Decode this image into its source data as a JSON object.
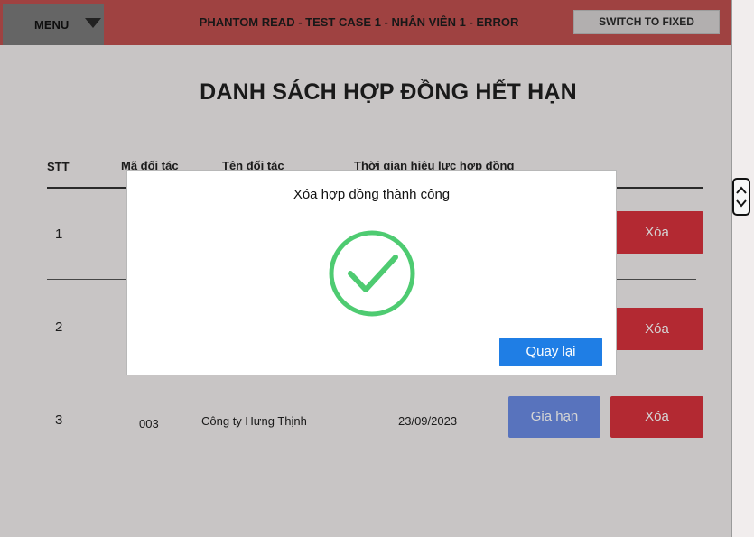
{
  "topbar": {
    "menu_label": "MENU",
    "title": "PHANTOM READ - TEST CASE 1 - NHÂN VIÊN 1 - ERROR",
    "switch_label": "SWITCH TO FIXED"
  },
  "page": {
    "title": "DANH SÁCH HỢP ĐỒNG HẾT HẠN"
  },
  "table": {
    "headers": [
      "STT",
      "Mã đối tác",
      "Tên đối tác",
      "Thời gian hiệu lực hợp đồng"
    ],
    "rows": [
      {
        "stt": "1",
        "delete_label": "Xóa"
      },
      {
        "stt": "2",
        "delete_label": "Xóa"
      },
      {
        "stt": "3",
        "code": "003",
        "name": "Công ty Hưng Thịnh",
        "date": "23/09/2023",
        "extend_label": "Gia hạn",
        "delete_label": "Xóa"
      }
    ]
  },
  "modal": {
    "message": "Xóa hợp đồng thành công",
    "icon": "check-circle-icon",
    "back_label": "Quay lại"
  },
  "colors": {
    "topbar": "#c0504f",
    "delete": "#d8323d",
    "extend": "#6a8be4",
    "back": "#1f7ee5",
    "check": "#4ecb71"
  }
}
